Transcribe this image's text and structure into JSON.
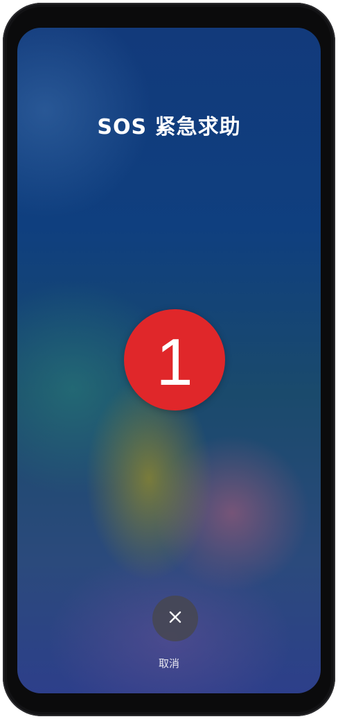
{
  "title": "SOS 紧急求助",
  "countdown": "1",
  "cancel": {
    "label": "取消",
    "icon": "close-icon"
  },
  "colors": {
    "countdown_circle": "#e0272a",
    "text": "#ffffff",
    "cancel_button_bg": "#46464f"
  }
}
